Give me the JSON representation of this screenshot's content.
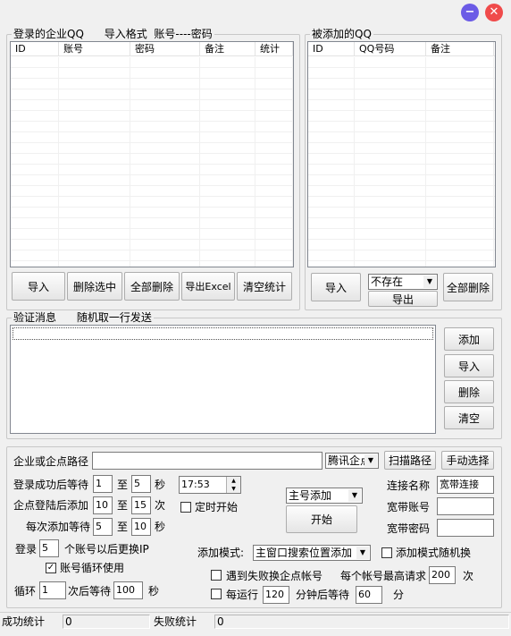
{
  "window": {
    "minimize_icon": "minus-icon",
    "close_icon": "close-icon",
    "minimize_color": "#6b5be6",
    "close_color": "#f04b4b"
  },
  "left_group": {
    "title": "登录的企业QQ      导入格式  账号----密码",
    "columns": [
      "ID",
      "账号",
      "密码",
      "备注",
      "统计"
    ],
    "buttons": {
      "import": "导入",
      "delete_selected": "删除选中",
      "delete_all": "全部删除",
      "export_excel": "导出Excel",
      "clear_stats": "清空统计"
    }
  },
  "right_group": {
    "title": "被添加的QQ",
    "columns": [
      "ID",
      "QQ号码",
      "备注"
    ],
    "buttons": {
      "import": "导入",
      "export": "导出",
      "delete_all": "全部删除"
    },
    "filter_select": "不存在"
  },
  "verify_group": {
    "title": "验证消息      随机取一行发送",
    "buttons": {
      "add": "添加",
      "import": "导入",
      "delete": "删除",
      "clear": "清空"
    }
  },
  "settings": {
    "path_label": "企业或企点路径",
    "path_value": "",
    "client_select": "腾讯企点",
    "scan_path": "扫描路径",
    "manual_select": "手动选择",
    "login_wait_label": "登录成功后等待",
    "login_wait_from": "1",
    "login_wait_to": "5",
    "to_label": "至",
    "seconds_label": "秒",
    "add_after_login_label": "企点登陆后添加",
    "add_from": "10",
    "add_to": "15",
    "times_label": "次",
    "each_wait_label": "每次添加等待",
    "each_wait_from": "5",
    "each_wait_to": "10",
    "time_value": "17:53",
    "timer_start_label": "定时开始",
    "main_account_select": "主号添加",
    "start_button": "开始",
    "connection_name_label": "连接名称",
    "connection_name_value": "宽带连接",
    "broadband_account_label": "宽带账号",
    "broadband_account_value": "",
    "broadband_password_label": "宽带密码",
    "broadband_password_value": "",
    "login_label": "登录",
    "switch_ip_count": "5",
    "switch_ip_label": "个账号以后更换IP",
    "loop_accounts_label": "账号循环使用",
    "loop_accounts_checked": true,
    "add_mode_label": "添加模式:",
    "add_mode_select": "主窗口搜索位置添加",
    "random_mode_label": "添加模式随机换",
    "fail_switch_label": "遇到失败换企点帐号",
    "max_requests_label": "每个帐号最高请求",
    "max_requests_value": "200",
    "loop_label": "循环",
    "loop_count": "1",
    "loop_wait_label": "次后等待",
    "loop_wait_value": "100",
    "every_run_label": "每运行",
    "every_run_value": "120",
    "minutes_wait_label": "分钟后等待",
    "minutes_wait_value": "60",
    "minutes_label": "分"
  },
  "status": {
    "success_label": "成功统计",
    "success_value": "0",
    "fail_label": "失败统计",
    "fail_value": "0"
  }
}
